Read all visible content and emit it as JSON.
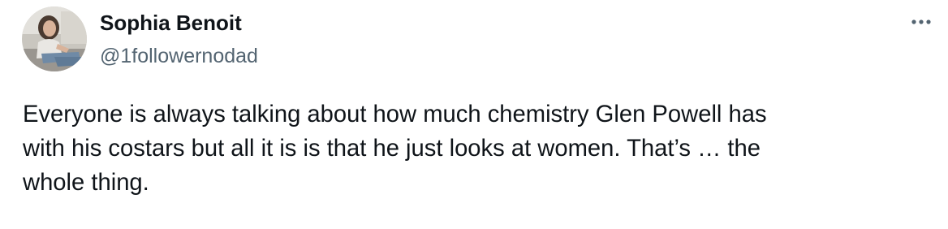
{
  "author": {
    "display_name": "Sophia Benoit",
    "handle": "@1followernodad",
    "avatar": "profile-photo"
  },
  "post": {
    "text": "Everyone is always talking about how much chemistry Glen Powell has\nwith his costars but all it is is that he just looks at women. That’s … the\nwhole thing."
  },
  "icons": {
    "more": "more-horizontal-icon"
  },
  "colors": {
    "text_primary": "#0f1419",
    "text_secondary": "#536471",
    "background": "#ffffff"
  }
}
